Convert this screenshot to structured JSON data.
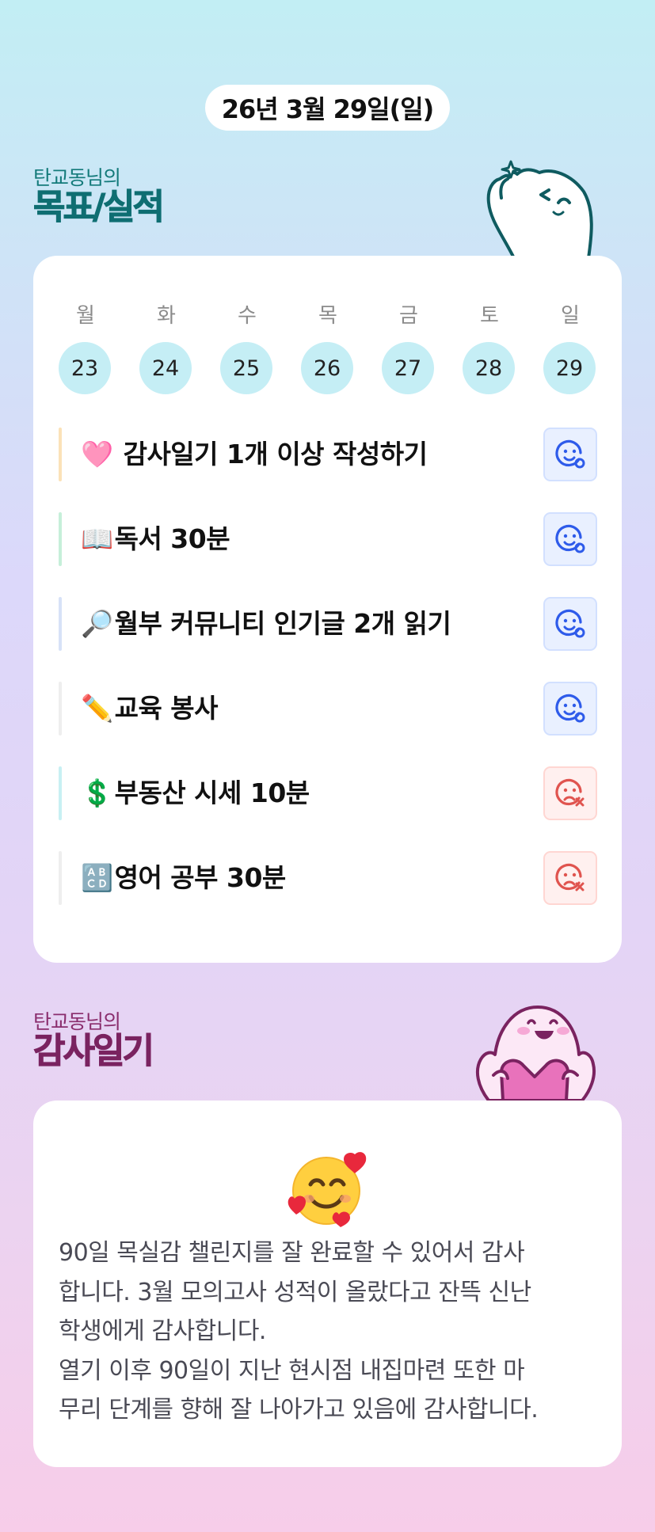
{
  "date": "26년 3월 29일(일)",
  "goals_section": {
    "owner": "탄교동님의",
    "title": "목표/실적"
  },
  "week": {
    "days": [
      {
        "name": "월",
        "num": "23"
      },
      {
        "name": "화",
        "num": "24"
      },
      {
        "name": "수",
        "num": "25"
      },
      {
        "name": "목",
        "num": "26"
      },
      {
        "name": "금",
        "num": "27"
      },
      {
        "name": "토",
        "num": "28"
      },
      {
        "name": "일",
        "num": "29"
      }
    ]
  },
  "goals": [
    {
      "emoji": "🩷",
      "text": " 감사일기 1개 이상 작성하기",
      "status": "done",
      "bar_color": "#fbe2b8"
    },
    {
      "emoji": "📖",
      "text": "독서 30분",
      "status": "done",
      "bar_color": "#c6efd9"
    },
    {
      "emoji": "🔎",
      "text": "월부 커뮤니티 인기글 2개 읽기",
      "status": "done",
      "bar_color": "#d7e2f7"
    },
    {
      "emoji": "✏️",
      "text": "교육 봉사",
      "status": "done",
      "bar_color": "#eeeeee"
    },
    {
      "emoji": "💲",
      "text": "부동산 시세 10분",
      "status": "fail",
      "bar_color": "#c8f0f3"
    },
    {
      "emoji": "🔠",
      "text": "영어 공부 30분",
      "status": "fail",
      "bar_color": "#eeeeee"
    }
  ],
  "status_icons": {
    "done": "smile-check-icon",
    "fail": "sad-x-icon"
  },
  "colors": {
    "done": "#2e5bea",
    "fail": "#e0544f",
    "teal_title": "#0f6e72",
    "plum_title": "#7a2360"
  },
  "diary_section": {
    "owner": "탄교동님의",
    "title": "감사일기"
  },
  "diary": {
    "mood_icon": "smiling-face-with-hearts-icon",
    "text": "90일 목실감 챌린지를 잘 완료할 수 있어서 감사\n합니다. 3월 모의고사 성적이 올랐다고 잔뜩 신난\n학생에게 감사합니다.\n열기 이후 90일이 지난 현시점 내집마련 또한 마\n무리 단계를 향해 잘 나아가고 있음에 감사합니다."
  }
}
